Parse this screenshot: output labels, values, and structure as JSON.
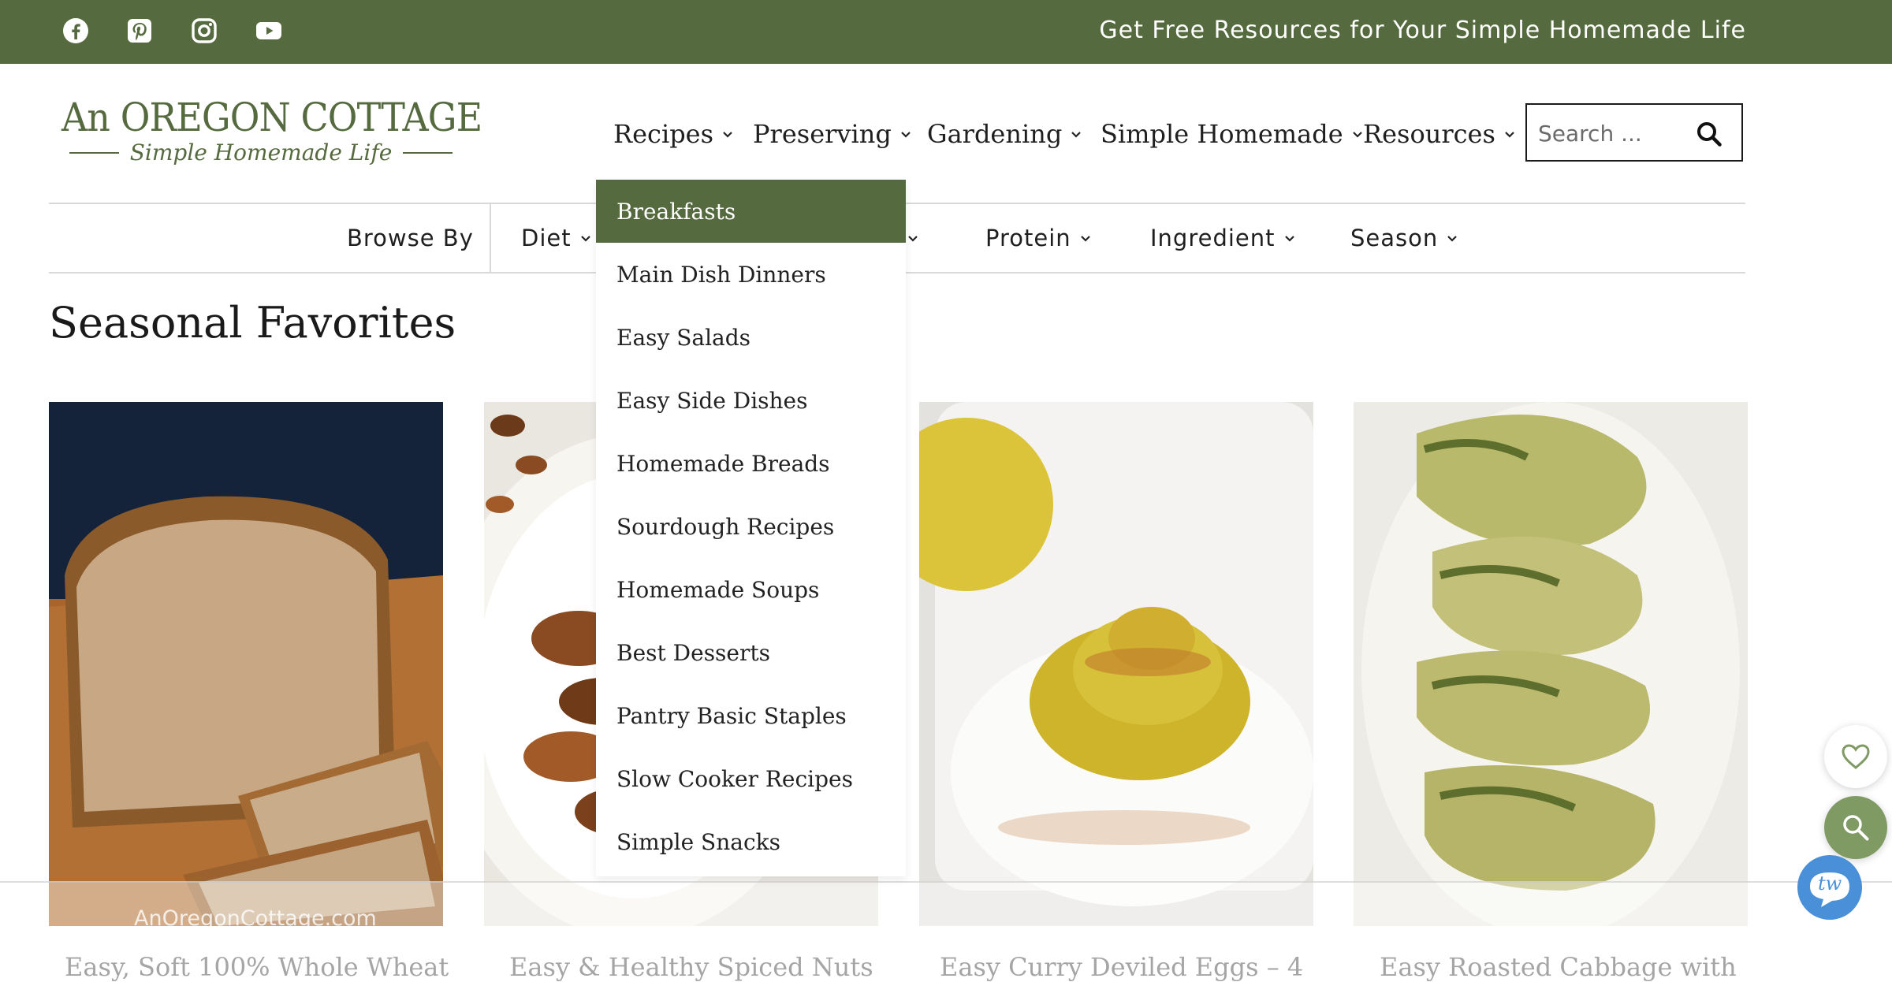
{
  "colors": {
    "brand_green": "#566a3f",
    "light_green": "#7f9a63",
    "tw_blue": "#4a90d9"
  },
  "topbar": {
    "social": [
      "facebook-icon",
      "pinterest-icon",
      "instagram-icon",
      "youtube-icon"
    ],
    "promo": "Get Free Resources for Your Simple Homemade Life"
  },
  "logo": {
    "main": "An OREGON COTTAGE",
    "sub": "Simple Homemade Life"
  },
  "nav": {
    "items": [
      {
        "label": "Recipes"
      },
      {
        "label": "Preserving"
      },
      {
        "label": "Gardening"
      },
      {
        "label": "Simple Homemade"
      },
      {
        "label": "Resources"
      }
    ]
  },
  "search": {
    "placeholder": "Search ...",
    "icon": "search-icon"
  },
  "subnav": {
    "browse_by": "Browse By",
    "items": [
      "Diet",
      "Protein",
      "Ingredient",
      "Season"
    ]
  },
  "dropdown": {
    "items": [
      "Breakfasts",
      "Main Dish Dinners",
      "Easy Salads",
      "Easy Side Dishes",
      "Homemade Breads",
      "Sourdough Recipes",
      "Homemade Soups",
      "Best Desserts",
      "Pantry Basic Staples",
      "Slow Cooker Recipes",
      "Simple Snacks"
    ],
    "active": "Breakfasts"
  },
  "section": {
    "heading": "Seasonal Favorites"
  },
  "cards": [
    {
      "title": "Easy, Soft 100% Whole Wheat",
      "watermark": "AnOregonCottage.com"
    },
    {
      "title": "Easy & Healthy Spiced Nuts"
    },
    {
      "title": "Easy Curry Deviled Eggs – 4"
    },
    {
      "title": "Easy Roasted Cabbage with"
    }
  ],
  "floating": {
    "tw_label": "tw"
  }
}
